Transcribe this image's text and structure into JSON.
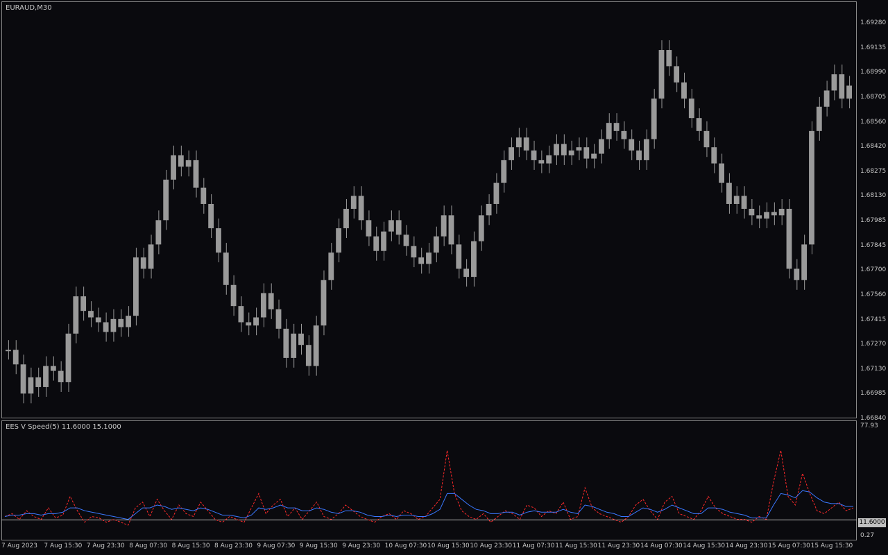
{
  "main_chart": {
    "title": "EURAUD,M30",
    "price_ticks": [
      "1.69280",
      "1.69135",
      "1.68990",
      "1.68705",
      "1.68560",
      "1.68420",
      "1.68275",
      "1.68130",
      "1.67985",
      "1.67845",
      "1.67700",
      "1.67560",
      "1.67415",
      "1.67270",
      "1.67130",
      "1.66985",
      "1.66840"
    ]
  },
  "indicator": {
    "title": "EES V Speed(5) 11.6000 15.1000",
    "top_value": "77.93",
    "bottom_value": "0.27",
    "current_value": "11.6000"
  },
  "time_axis": [
    "7 Aug 2023",
    "7 Aug 15:30",
    "7 Aug 23:30",
    "8 Aug 07:30",
    "8 Aug 15:30",
    "8 Aug 23:30",
    "9 Aug 07:30",
    "9 Aug 15:30",
    "9 Aug 23:30",
    "10 Aug 07:30",
    "10 Aug 15:30",
    "10 Aug 23:30",
    "11 Aug 07:30",
    "11 Aug 15:30",
    "11 Aug 23:30",
    "14 Aug 07:30",
    "14 Aug 15:30",
    "14 Aug 23:30",
    "15 Aug 07:30",
    "15 Aug 15:30"
  ],
  "colors": {
    "background": "#0a0a0e",
    "candle": "#9a9a9a",
    "speed_fast": "#ff2a2a",
    "speed_slow": "#3a78ff",
    "level": "#c0c0c0"
  },
  "chart_data": [
    {
      "type": "line",
      "title": "EURAUD,M30",
      "ylim": [
        1.6684,
        1.6928
      ],
      "series": [
        {
          "name": "EURAUD,M30",
          "values": [
            1.6725,
            1.6716,
            1.6698,
            1.6708,
            1.6702,
            1.6715,
            1.6712,
            1.6705,
            1.6735,
            1.6758,
            1.6749,
            1.6745,
            1.6742,
            1.6736,
            1.6744,
            1.6739,
            1.6746,
            1.6782,
            1.6775,
            1.679,
            1.6805,
            1.683,
            1.6845,
            1.6838,
            1.6842,
            1.6825,
            1.6815,
            1.68,
            1.6785,
            1.6765,
            1.6752,
            1.6742,
            1.674,
            1.6745,
            1.676,
            1.675,
            1.6738,
            1.672,
            1.6735,
            1.6728,
            1.6715,
            1.674,
            1.6768,
            1.6785,
            1.68,
            1.6812,
            1.682,
            1.6805,
            1.6795,
            1.6786,
            1.6798,
            1.6805,
            1.6796,
            1.6789,
            1.6782,
            1.6778,
            1.6785,
            1.6795,
            1.6808,
            1.679,
            1.6775,
            1.677,
            1.6792,
            1.6808,
            1.6815,
            1.6828,
            1.6842,
            1.685,
            1.6856,
            1.6848,
            1.6842,
            1.684,
            1.6845,
            1.6852,
            1.6845,
            1.6848,
            1.685,
            1.6843,
            1.6846,
            1.6855,
            1.6865,
            1.686,
            1.6855,
            1.6848,
            1.6842,
            1.6855,
            1.688,
            1.691,
            1.69,
            1.689,
            1.688,
            1.6868,
            1.686,
            1.685,
            1.684,
            1.6828,
            1.6815,
            1.682,
            1.6812,
            1.6808,
            1.6806,
            1.681,
            1.6808,
            1.6812,
            1.6775,
            1.6768,
            1.679,
            1.686,
            1.6875,
            1.6885,
            1.6895,
            1.688,
            1.6888
          ]
        }
      ]
    },
    {
      "type": "line",
      "title": "EES V Speed(5) 11.6000 15.1000",
      "ylim": [
        0.27,
        77.93
      ],
      "series": [
        {
          "name": "11.6000",
          "values": [
            14,
            16,
            12,
            18,
            14,
            12,
            20,
            13,
            15,
            28,
            18,
            10,
            14,
            13,
            10,
            12,
            10,
            8,
            20,
            24,
            14,
            26,
            18,
            12,
            22,
            16,
            14,
            24,
            18,
            12,
            10,
            14,
            12,
            10,
            20,
            30,
            16,
            22,
            26,
            14,
            20,
            12,
            18,
            24,
            14,
            12,
            16,
            22,
            18,
            14,
            12,
            10,
            14,
            16,
            12,
            18,
            16,
            12,
            14,
            20,
            26,
            60,
            30,
            18,
            14,
            12,
            16,
            10,
            14,
            18,
            16,
            12,
            22,
            20,
            14,
            18,
            16,
            24,
            12,
            14,
            34,
            20,
            16,
            14,
            12,
            10,
            14,
            22,
            26,
            18,
            12,
            24,
            28,
            16,
            14,
            12,
            18,
            28,
            20,
            16,
            14,
            12,
            12,
            10,
            14,
            12,
            38,
            60,
            28,
            22,
            44,
            30,
            18,
            16,
            20,
            24,
            18,
            20
          ]
        },
        {
          "name": "15.1000",
          "values": [
            14,
            15,
            15,
            16,
            16,
            15,
            16,
            16,
            17,
            20,
            20,
            18,
            17,
            16,
            15,
            14,
            13,
            12,
            16,
            20,
            20,
            22,
            21,
            19,
            20,
            19,
            18,
            20,
            19,
            17,
            15,
            15,
            14,
            13,
            15,
            20,
            19,
            20,
            22,
            20,
            20,
            18,
            18,
            20,
            19,
            17,
            16,
            18,
            18,
            17,
            15,
            14,
            14,
            15,
            14,
            15,
            15,
            14,
            14,
            16,
            19,
            30,
            30,
            26,
            22,
            19,
            18,
            16,
            16,
            17,
            17,
            15,
            17,
            18,
            17,
            17,
            17,
            19,
            17,
            16,
            22,
            21,
            19,
            17,
            16,
            14,
            14,
            17,
            20,
            19,
            17,
            19,
            22,
            20,
            18,
            16,
            16,
            20,
            20,
            19,
            17,
            16,
            15,
            13,
            13,
            13,
            22,
            30,
            29,
            27,
            32,
            31,
            27,
            24,
            23,
            23,
            21,
            21
          ]
        }
      ]
    }
  ]
}
